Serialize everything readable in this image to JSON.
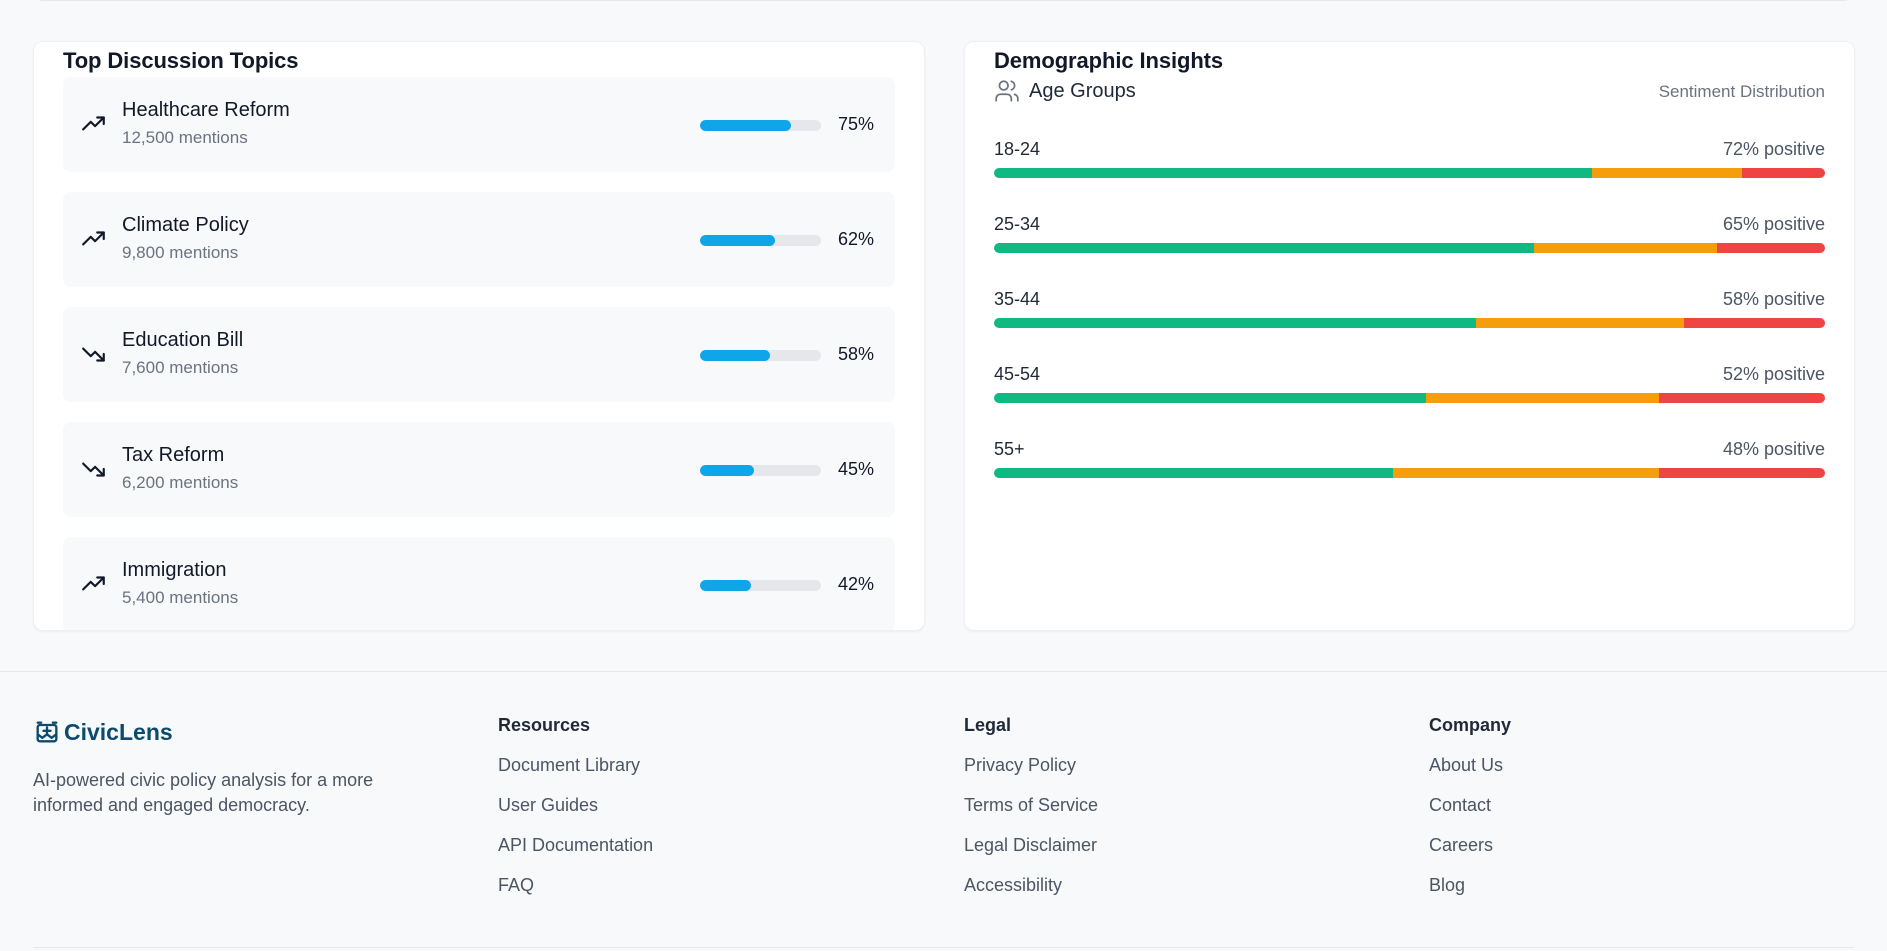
{
  "topics": {
    "title": "Top Discussion Topics",
    "items": [
      {
        "name": "Healthcare Reform",
        "mentions": "12,500 mentions",
        "percent": 75,
        "percent_label": "75%",
        "trend": "up"
      },
      {
        "name": "Climate Policy",
        "mentions": "9,800 mentions",
        "percent": 62,
        "percent_label": "62%",
        "trend": "up"
      },
      {
        "name": "Education Bill",
        "mentions": "7,600 mentions",
        "percent": 58,
        "percent_label": "58%",
        "trend": "down"
      },
      {
        "name": "Tax Reform",
        "mentions": "6,200 mentions",
        "percent": 45,
        "percent_label": "45%",
        "trend": "down"
      },
      {
        "name": "Immigration",
        "mentions": "5,400 mentions",
        "percent": 42,
        "percent_label": "42%",
        "trend": "up"
      }
    ]
  },
  "demographics": {
    "title": "Demographic Insights",
    "subtitle": "Age Groups",
    "distribution_label": "Sentiment Distribution",
    "groups": [
      {
        "label": "18-24",
        "positive_label": "72% positive",
        "positive": 72,
        "neutral": 18,
        "negative": 10
      },
      {
        "label": "25-34",
        "positive_label": "65% positive",
        "positive": 65,
        "neutral": 22,
        "negative": 13
      },
      {
        "label": "35-44",
        "positive_label": "58% positive",
        "positive": 58,
        "neutral": 25,
        "negative": 17
      },
      {
        "label": "45-54",
        "positive_label": "52% positive",
        "positive": 52,
        "neutral": 28,
        "negative": 20
      },
      {
        "label": "55+",
        "positive_label": "48% positive",
        "positive": 48,
        "neutral": 32,
        "negative": 20
      }
    ]
  },
  "colors": {
    "progress": "#0ea5e9",
    "positive": "#10b981",
    "neutral": "#f59e0b",
    "negative": "#ef4444",
    "brand": "#0c4a6e"
  },
  "footer": {
    "brand": "CivicLens",
    "tagline": "AI-powered civic policy analysis for a more informed and engaged democracy.",
    "resources": {
      "heading": "Resources",
      "links": [
        "Document Library",
        "User Guides",
        "API Documentation",
        "FAQ"
      ]
    },
    "legal": {
      "heading": "Legal",
      "links": [
        "Privacy Policy",
        "Terms of Service",
        "Legal Disclaimer",
        "Accessibility"
      ]
    },
    "company": {
      "heading": "Company",
      "links": [
        "About Us",
        "Contact",
        "Careers",
        "Blog"
      ]
    }
  }
}
